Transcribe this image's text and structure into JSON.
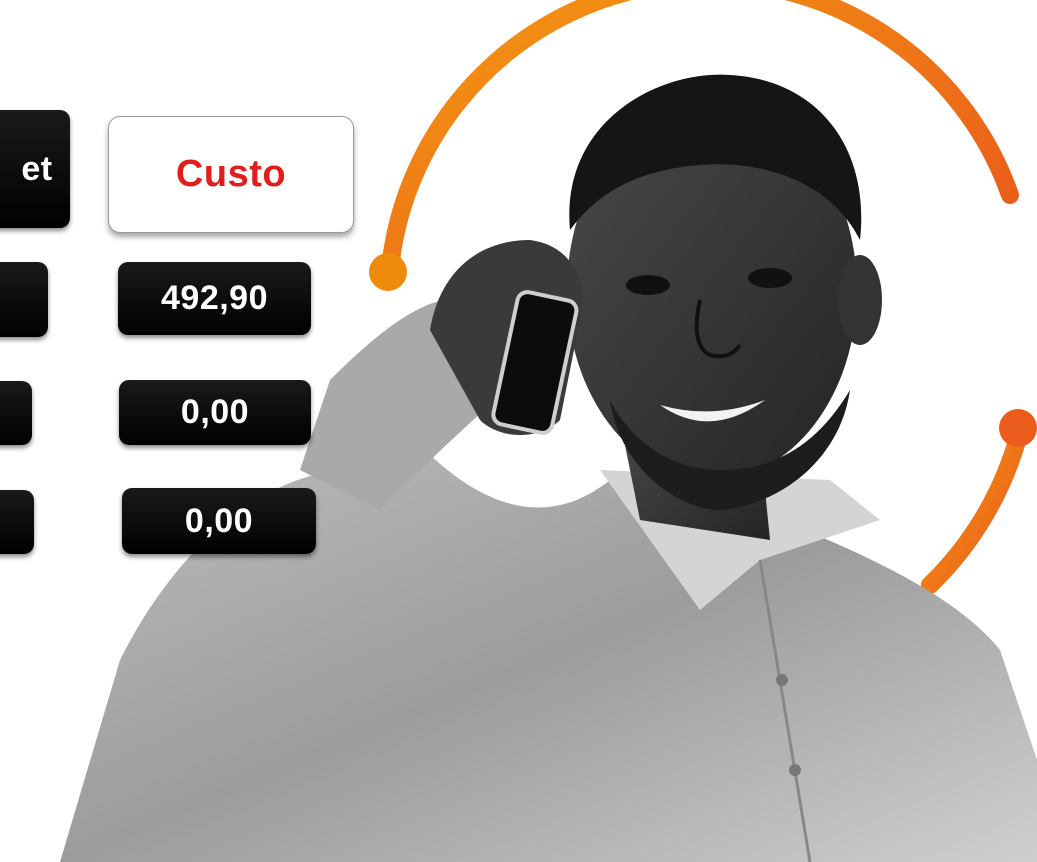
{
  "header": {
    "left_label_fragment": "et",
    "cost_label": "Custo"
  },
  "rows": [
    {
      "cost_value": "492,90"
    },
    {
      "cost_value": "0,00"
    },
    {
      "cost_value": "0,00"
    }
  ],
  "colors": {
    "accent_orange": "#f0820a",
    "accent_red": "#e31c1c",
    "button_dark": "#000000",
    "button_text": "#ffffff"
  },
  "photo": {
    "icon": "man-on-phone-photo"
  }
}
